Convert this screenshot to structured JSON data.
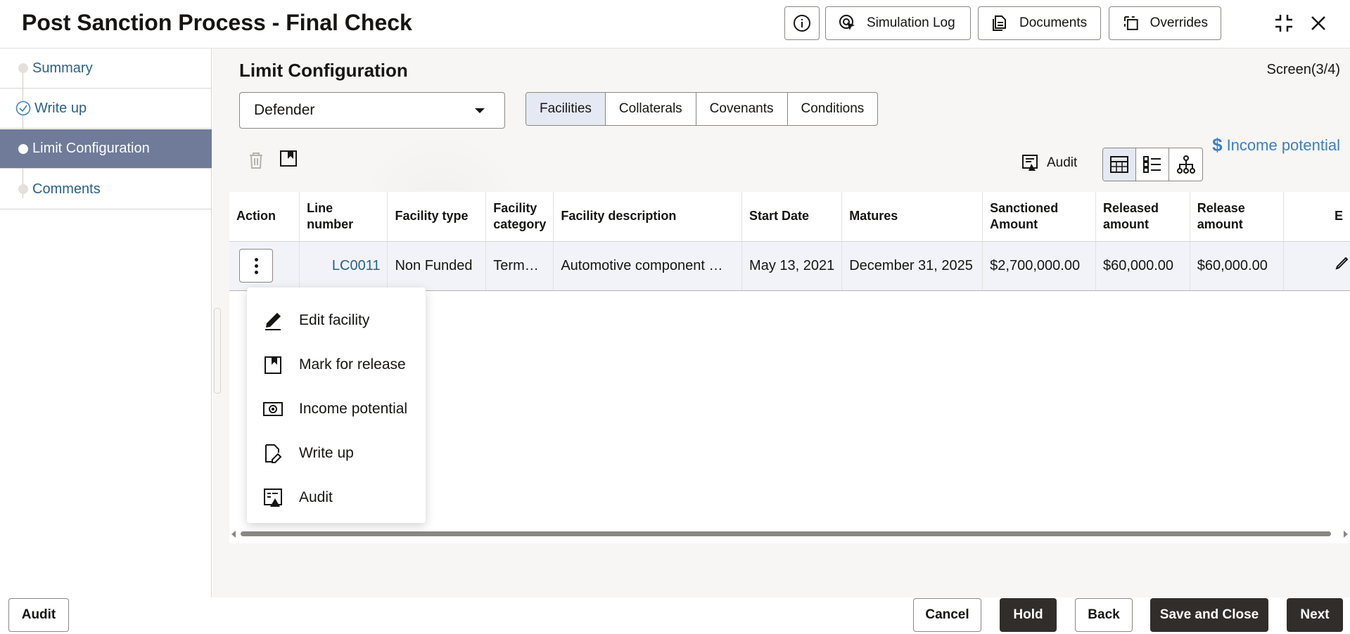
{
  "header": {
    "title": "Post Sanction Process - Final Check",
    "buttons": {
      "simulation_log": "Simulation Log",
      "documents": "Documents",
      "overrides": "Overrides"
    }
  },
  "sidebar": {
    "items": [
      {
        "label": "Summary",
        "state": "pending"
      },
      {
        "label": "Write up",
        "state": "completed"
      },
      {
        "label": "Limit Configuration",
        "state": "active"
      },
      {
        "label": "Comments",
        "state": "pending"
      }
    ]
  },
  "main": {
    "section_title": "Limit Configuration",
    "screen_indicator": "Screen(3/4)",
    "select_value": "Defender",
    "tabs": [
      "Facilities",
      "Collaterals",
      "Covenants",
      "Conditions"
    ],
    "selected_tab": "Facilities",
    "income_potential": {
      "symbol": "$",
      "label": "Income potential"
    },
    "audit_label": "Audit"
  },
  "table": {
    "headers": [
      "Action",
      "Line number",
      "Facility type",
      "Facility category",
      "Facility description",
      "Start Date",
      "Matures",
      "Sanctioned Amount",
      "Released amount",
      "Release amount",
      "E"
    ],
    "rows": [
      {
        "line_number": "LC0011",
        "facility_type": "Non Funded",
        "facility_category": "Term…",
        "facility_description": "Automotive component …",
        "start_date": "May 13, 2021",
        "matures": "December 31, 2025",
        "sanctioned_amount": "$2,700,000.00",
        "released_amount": "$60,000.00",
        "release_amount": "$60,000.00"
      }
    ]
  },
  "menu": {
    "items": [
      {
        "label": "Edit facility",
        "icon": "edit-icon"
      },
      {
        "label": "Mark for release",
        "icon": "flag-document-icon"
      },
      {
        "label": "Income potential",
        "icon": "money-icon"
      },
      {
        "label": "Write up",
        "icon": "document-edit-icon"
      },
      {
        "label": "Audit",
        "icon": "audit-icon"
      }
    ]
  },
  "footer": {
    "audit": "Audit",
    "cancel": "Cancel",
    "hold": "Hold",
    "back": "Back",
    "save_close": "Save and Close",
    "next": "Next"
  },
  "colors": {
    "accent_link": "#2a6286",
    "active_step_bg": "#6f7b99",
    "dark_button": "#312d2a",
    "income_link": "#3d7fc2"
  }
}
